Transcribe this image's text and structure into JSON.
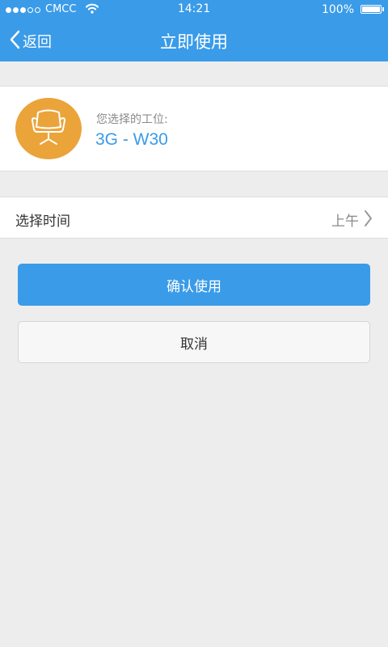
{
  "status_bar": {
    "carrier": "CMCC",
    "time": "14:21",
    "battery": "100%",
    "signal_bars_filled": 3,
    "signal_bars_total": 5
  },
  "nav": {
    "back_label": "返回",
    "title": "立即使用"
  },
  "workstation": {
    "label": "您选择的工位:",
    "value": "3G - W30",
    "icon": "chair-icon",
    "icon_bg": "#eba43a"
  },
  "time_row": {
    "label": "选择时间",
    "value": "上午"
  },
  "actions": {
    "confirm_label": "确认使用",
    "cancel_label": "取消"
  },
  "colors": {
    "primary": "#3a9be8",
    "background": "#ededed"
  }
}
